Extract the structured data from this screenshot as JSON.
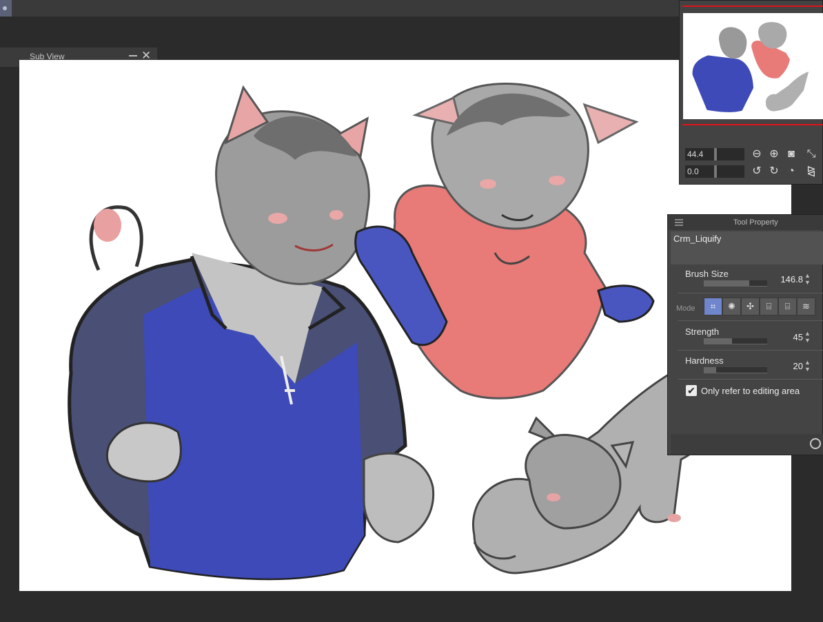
{
  "sub_view": {
    "title": "Sub View"
  },
  "navigator": {
    "zoom_value": "44.4",
    "rotate_value": "0.0",
    "icons": [
      "zoom-out-icon",
      "zoom-in-icon",
      "fit-screen-icon",
      "actual-size-icon",
      "rotate-left-icon",
      "rotate-right-icon",
      "reset-rotation-icon",
      "flip-horizontal-icon"
    ]
  },
  "tool_property": {
    "title": "Tool Property",
    "subtool_name": "Crm_Liquify",
    "brush_size": {
      "label": "Brush Size",
      "value": "146.8",
      "fraction": 0.72
    },
    "mode": {
      "label": "Mode",
      "options": [
        "push",
        "expand",
        "pinch",
        "twist-left",
        "twist-right",
        "wave",
        "zigzag"
      ],
      "selected": 0
    },
    "strength": {
      "label": "Strength",
      "value": "45",
      "fraction": 0.45
    },
    "hardness": {
      "label": "Hardness",
      "value": "20",
      "fraction": 0.2
    },
    "only_refer": {
      "label": "Only refer to editing area",
      "checked": true
    }
  },
  "colors": {
    "shirt_blue": "#3d4ab8",
    "hoodie_red": "#e87a78",
    "fur_grey": "#9a9a9a",
    "accent_red": "#e0121b",
    "selected_mode": "#6f86cc"
  }
}
